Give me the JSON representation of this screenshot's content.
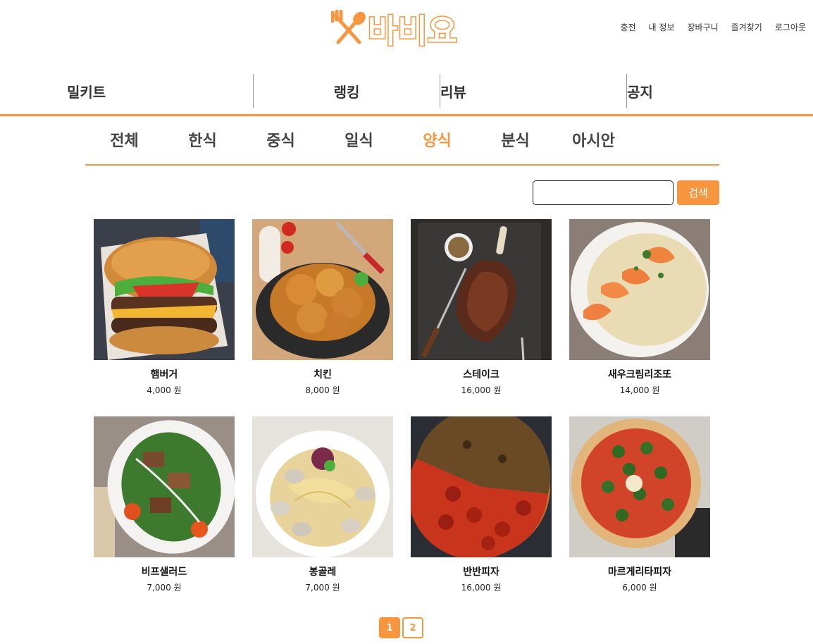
{
  "header": {
    "logo_text": "바비요",
    "links": [
      "충전",
      "내 정보",
      "장바구니",
      "즐겨찾기",
      "로그아웃"
    ]
  },
  "main_nav": [
    "밀키트",
    "랭킹",
    "리뷰",
    "공지"
  ],
  "categories": {
    "items": [
      "전체",
      "한식",
      "중식",
      "일식",
      "양식",
      "분식",
      "아시안"
    ],
    "active": "양식"
  },
  "search": {
    "button_label": "검색",
    "value": ""
  },
  "products": [
    {
      "name": "햄버거",
      "price": "4,000 원"
    },
    {
      "name": "치킨",
      "price": "8,000 원"
    },
    {
      "name": "스테이크",
      "price": "16,000 원"
    },
    {
      "name": "새우크림리조또",
      "price": "14,000 원"
    },
    {
      "name": "비프샐러드",
      "price": "7,000 원"
    },
    {
      "name": "봉골레",
      "price": "7,000 원"
    },
    {
      "name": "반반피자",
      "price": "16,000 원"
    },
    {
      "name": "마르게리타피자",
      "price": "6,000 원"
    }
  ],
  "pagination": {
    "pages": [
      "1",
      "2"
    ],
    "current": "1"
  },
  "colors": {
    "accent": "#f7963e",
    "text": "#333333"
  }
}
